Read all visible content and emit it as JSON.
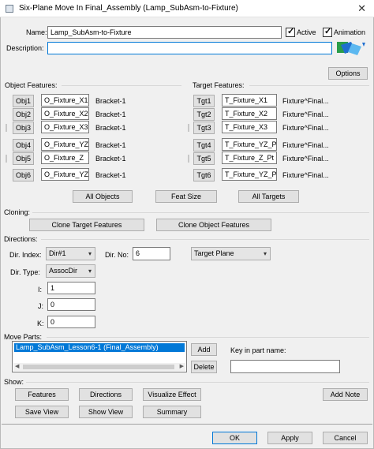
{
  "window": {
    "title": "Six-Plane Move In Final_Assembly (Lamp_SubAsm-to-Fixture)",
    "close_glyph": "✕"
  },
  "name_row": {
    "name_label": "Name:",
    "name_value": "Lamp_SubAsm-to-Fixture",
    "active_label": "Active",
    "animation_label": "Animation",
    "description_label": "Description:",
    "description_value": ""
  },
  "options_button": "Options",
  "object_features": {
    "header": "Object Features:",
    "rows": [
      {
        "btn": "Obj1",
        "feature": "O_Fixture_X1",
        "part": "Bracket-1"
      },
      {
        "btn": "Obj2",
        "feature": "O_Fixture_X2",
        "part": "Bracket-1"
      },
      {
        "btn": "Obj3",
        "feature": "O_Fixture_X3",
        "part": "Bracket-1"
      },
      {
        "btn": "Obj4",
        "feature": "O_Fixture_YZ",
        "part": "Bracket-1"
      },
      {
        "btn": "Obj5",
        "feature": "O_Fixture_Z",
        "part": "Bracket-1"
      },
      {
        "btn": "Obj6",
        "feature": "O_Fixture_YZ",
        "part": "Bracket-1"
      }
    ]
  },
  "target_features": {
    "header": "Target Features:",
    "rows": [
      {
        "btn": "Tgt1",
        "feature": "T_Fixture_X1",
        "part": "Fixture^Final..."
      },
      {
        "btn": "Tgt2",
        "feature": "T_Fixture_X2",
        "part": "Fixture^Final..."
      },
      {
        "btn": "Tgt3",
        "feature": "T_Fixture_X3",
        "part": "Fixture^Final..."
      },
      {
        "btn": "Tgt4",
        "feature": "T_Fixture_YZ_P",
        "part": "Fixture^Final..."
      },
      {
        "btn": "Tgt5",
        "feature": "T_Fixture_Z_Pt",
        "part": "Fixture^Final..."
      },
      {
        "btn": "Tgt6",
        "feature": "T_Fixture_YZ_P",
        "part": "Fixture^Final..."
      }
    ]
  },
  "feature_buttons": {
    "all_objects": "All Objects",
    "feat_size": "Feat Size",
    "all_targets": "All Targets"
  },
  "cloning": {
    "header": "Cloning:",
    "clone_target": "Clone Target Features",
    "clone_object": "Clone Object Features"
  },
  "directions": {
    "header": "Directions:",
    "dir_index_label": "Dir. Index:",
    "dir_index_value": "Dir#1",
    "dir_no_label": "Dir. No:",
    "dir_no_value": "6",
    "plane_value": "Target Plane",
    "dir_type_label": "Dir. Type:",
    "dir_type_value": "AssocDir",
    "i_label": "I:",
    "i_value": "1",
    "j_label": "J:",
    "j_value": "0",
    "k_label": "K:",
    "k_value": "0"
  },
  "move_parts": {
    "header": "Move Parts:",
    "items": [
      "Lamp_SubAsm_Lesson6-1 (Final_Assembly)"
    ],
    "add": "Add",
    "delete": "Delete",
    "key_label": "Key in part name:",
    "key_value": ""
  },
  "show": {
    "header": "Show:",
    "features": "Features",
    "directions": "Directions",
    "visualize": "Visualize Effect",
    "add_note": "Add Note",
    "save_view": "Save View",
    "show_view": "Show View",
    "summary": "Summary"
  },
  "footer": {
    "ok": "OK",
    "apply": "Apply",
    "cancel": "Cancel"
  },
  "colors": {
    "accent": "#0078d7",
    "selection": "#0078d7"
  }
}
